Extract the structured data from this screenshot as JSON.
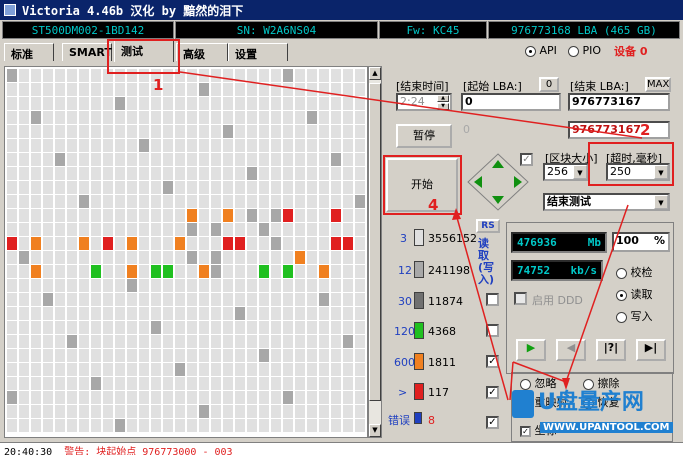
{
  "title": "Victoria 4.46b 汉化 by 黯然的泪下",
  "info": {
    "model": "ST500DM002-1BD142",
    "sn": "SN: W2A6NS04",
    "fw": "Fw: KC45",
    "lba": "976773168 LBA (465 GB)"
  },
  "tabs": [
    "标准",
    "SMART",
    "测试",
    "高级",
    "设置"
  ],
  "mode": {
    "api": "API",
    "pio": "PIO",
    "device_label": "设备",
    "device_num": "0"
  },
  "times": {
    "end_time_label": "[结束时间]",
    "end_time": "2:24",
    "start_lba_label": "[起始 LBA:]",
    "zero_btn": "0",
    "start_lba": "0",
    "end_lba_label": "[结束 LBA:]",
    "max_btn": "MAX",
    "end_lba": "976773167",
    "end_lba2": "976773167",
    "faded_zero": "0"
  },
  "buttons": {
    "pause": "暂停",
    "start": "开始",
    "rs": "RS"
  },
  "block": {
    "size_label": "[区块大小]",
    "size": "256",
    "timeout_label": "[超时,毫秒]",
    "timeout": "250",
    "end_test": "结束测试"
  },
  "legend": [
    {
      "label": "3",
      "count": "3556152",
      "color": "#e0e0e0"
    },
    {
      "label": "12",
      "count": "241198",
      "color": "#a8a8a8"
    },
    {
      "label": "30",
      "count": "11874",
      "color": "#707070"
    },
    {
      "label": "120",
      "count": "4368",
      "color": "#20c020"
    },
    {
      "label": "600",
      "count": "1811",
      "color": "#f08020"
    },
    {
      "label": ">",
      "count": "117",
      "color": "#e02020"
    },
    {
      "label": "错误",
      "count": "8",
      "color": "#2040c0"
    }
  ],
  "vertical_label": "读取(写入)",
  "readout": {
    "mb": "476936",
    "mb_unit": "Mb",
    "pct": "100",
    "pct_unit": "%",
    "kbs": "74752",
    "kbs_unit": "kb/s",
    "ddd": "启用 DDD"
  },
  "rw": {
    "verify": "校检",
    "read": "读取",
    "write": "写入"
  },
  "play": {
    "play": "▶",
    "back": "◀",
    "skip": "|?|",
    "end": "▶|"
  },
  "repair": {
    "ignore": "忽略",
    "erase": "擦除",
    "remap": "重映射",
    "restore": "恢复",
    "grid": "坐标"
  },
  "annotations": {
    "n1": "1",
    "n2": "2",
    "n3": "3",
    "n4": "4"
  },
  "status_line": {
    "time": "20:40:30",
    "msg": "警告: 块起始点 976773000 - 003"
  },
  "watermark": {
    "brand": "U盘量产网",
    "url": "WWW.UPANTOOL.COM"
  },
  "colors": {
    "accent": "#e02020",
    "lcd_text": "#00c8c8",
    "title_bg": "#0a246a"
  }
}
